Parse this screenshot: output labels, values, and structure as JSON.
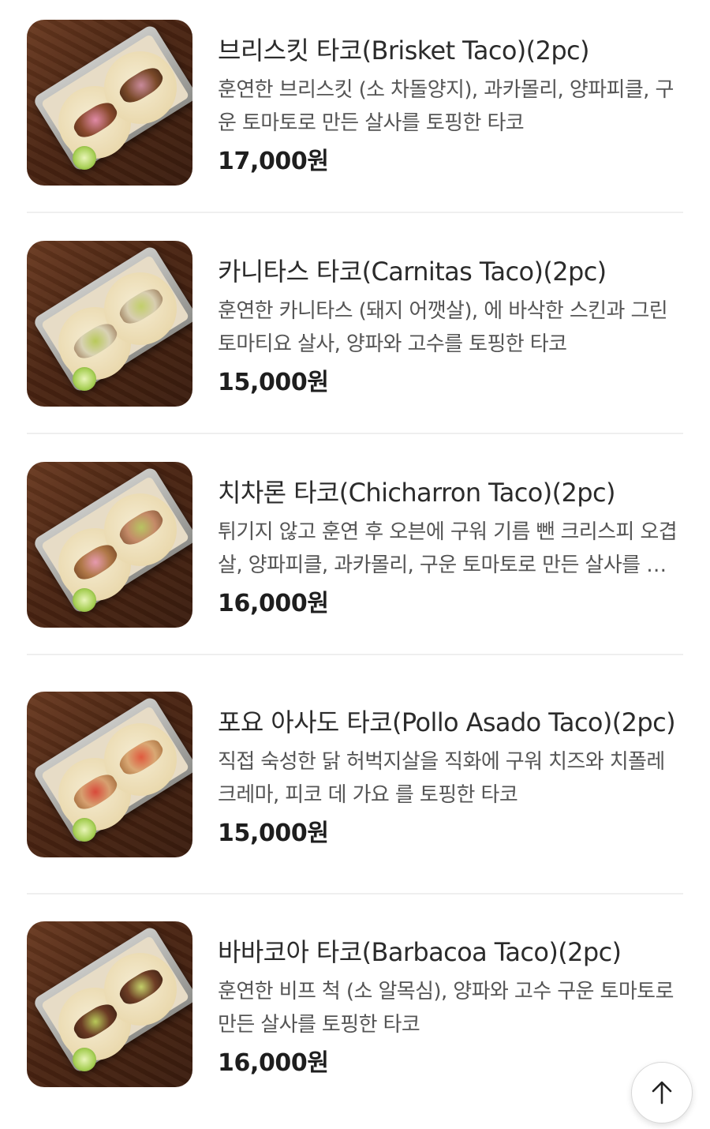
{
  "menu_items": [
    {
      "name": "브리스킷 타코(Brisket Taco)(2pc)",
      "description": "훈연한 브리스킷 (소 차돌양지), 과카몰리, 양파피클, 구운 토마토로 만든 살사를 토핑한 타코",
      "price": "17,000원",
      "image_icon": "brisket-taco-photo"
    },
    {
      "name": "카니타스 타코(Carnitas Taco)(2pc)",
      "description": "훈연한 카니타스 (돼지 어깻살), 에 바삭한 스킨과 그린 토마티요 살사, 양파와 고수를 토핑한 타코",
      "price": "15,000원",
      "image_icon": "carnitas-taco-photo"
    },
    {
      "name": "치차론 타코(Chicharron Taco)(2pc)",
      "description": "튀기지 않고 훈연 후 오븐에 구워 기름 뺀 크리스피 오겹살, 양파피클, 과카몰리, 구운 토마토로 만든 살사를 토핑한 타코",
      "price": "16,000원",
      "image_icon": "chicharron-taco-photo"
    },
    {
      "name": "포요 아사도 타코(Pollo Asado Taco)(2pc)",
      "description": "직접 숙성한 닭 허벅지살을 직화에 구워 치즈와 치폴레 크레마, 피코 데 가요 를 토핑한 타코",
      "price": "15,000원",
      "image_icon": "pollo-asado-taco-photo"
    },
    {
      "name": "바바코아 타코(Barbacoa Taco)(2pc)",
      "description": "훈연한 비프 척 (소 알목심), 양파와 고수 구운 토마토로 만든 살사를 토핑한 타코",
      "price": "16,000원",
      "image_icon": "barbacoa-taco-photo"
    }
  ],
  "scroll_top_button": {
    "icon": "arrow-up-icon"
  }
}
